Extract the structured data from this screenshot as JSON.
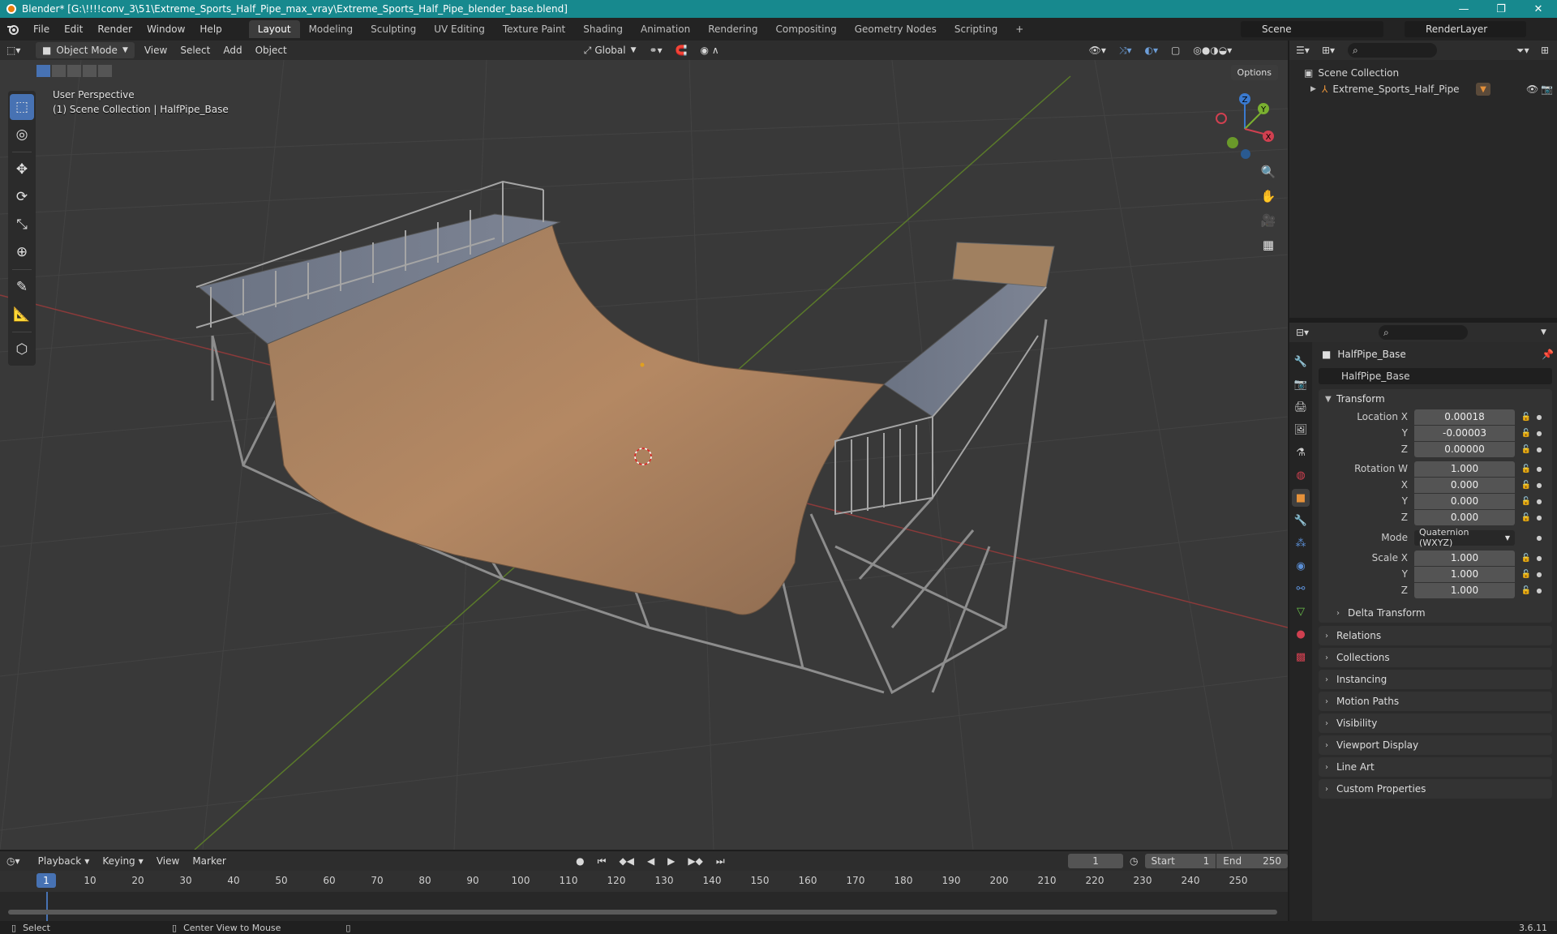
{
  "window": {
    "title": "Blender* [G:\\!!!!conv_3\\51\\Extreme_Sports_Half_Pipe_max_vray\\Extreme_Sports_Half_Pipe_blender_base.blend]",
    "controls": [
      "—",
      "❐",
      "✕"
    ]
  },
  "menu": {
    "items": [
      "File",
      "Edit",
      "Render",
      "Window",
      "Help"
    ],
    "workspaces": [
      "Layout",
      "Modeling",
      "Sculpting",
      "UV Editing",
      "Texture Paint",
      "Shading",
      "Animation",
      "Rendering",
      "Compositing",
      "Geometry Nodes",
      "Scripting"
    ],
    "active_workspace": "Layout",
    "add_tab": "+",
    "scene": "Scene",
    "render_layer": "RenderLayer"
  },
  "viewport_header": {
    "mode": "Object Mode",
    "menus": [
      "View",
      "Select",
      "Add",
      "Object"
    ],
    "orientation": "Global",
    "options": "Options"
  },
  "viewport": {
    "perspective": "User Perspective",
    "collection_info": "(1) Scene Collection | HalfPipe_Base",
    "axis_labels": {
      "z": "Z",
      "y": "Y",
      "x": "X"
    }
  },
  "outliner": {
    "root": "Scene Collection",
    "items": [
      {
        "name": "Extreme_Sports_Half_Pipe"
      }
    ]
  },
  "properties": {
    "object_name": "HalfPipe_Base",
    "data_name": "HalfPipe_Base",
    "transform_title": "Transform",
    "location": {
      "label": "Location X",
      "x": "0.00018",
      "y": "-0.00003",
      "z": "0.00000"
    },
    "rotation": {
      "label": "Rotation W",
      "w": "1.000",
      "x": "0.000",
      "y": "0.000",
      "z": "0.000"
    },
    "mode": {
      "label": "Mode",
      "value": "Quaternion (WXYZ)"
    },
    "scale": {
      "label": "Scale X",
      "x": "1.000",
      "y": "1.000",
      "z": "1.000"
    },
    "axis_y": "Y",
    "axis_z": "Z",
    "axis_x": "X",
    "delta": "Delta Transform",
    "sections": [
      "Relations",
      "Collections",
      "Instancing",
      "Motion Paths",
      "Visibility",
      "Viewport Display",
      "Line Art",
      "Custom Properties"
    ]
  },
  "timeline": {
    "menus": [
      "Playback",
      "Keying",
      "View",
      "Marker"
    ],
    "current_frame": "1",
    "start_label": "Start",
    "start": "1",
    "end_label": "End",
    "end": "250",
    "ruler_current": "1",
    "ticks": [
      "10",
      "20",
      "30",
      "40",
      "50",
      "60",
      "70",
      "80",
      "90",
      "100",
      "110",
      "120",
      "130",
      "140",
      "150",
      "160",
      "170",
      "180",
      "190",
      "200",
      "210",
      "220",
      "230",
      "240",
      "250"
    ]
  },
  "status": {
    "select": "Select",
    "center_view": "Center View to Mouse",
    "version": "3.6.11"
  }
}
